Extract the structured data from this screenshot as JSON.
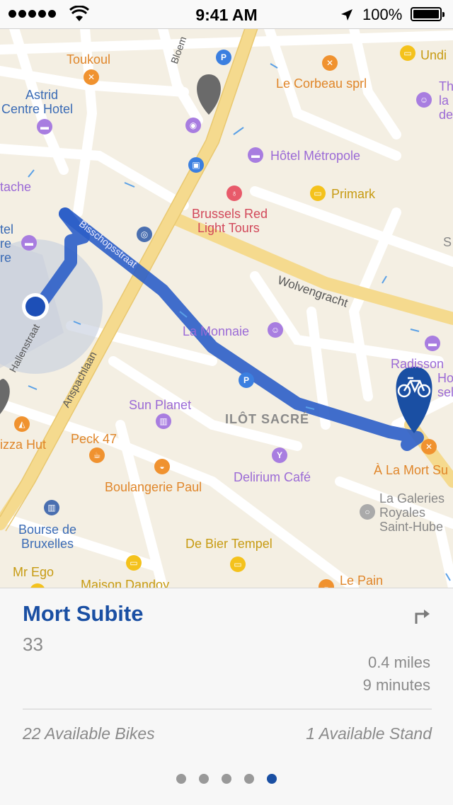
{
  "status_bar": {
    "time": "9:41 AM",
    "battery": "100%",
    "signal_dots": 5
  },
  "map": {
    "labels": {
      "toukoul": "Toukoul",
      "astrid": "Astrid",
      "centre_hotel": "Centre Hotel",
      "tache": "tache",
      "tel": "tel",
      "re": "re",
      "re2": "re",
      "corbeau": "Le Corbeau sprl",
      "metropole": "Hôtel Métropole",
      "primark": "Primark",
      "brussels_red": "Brussels Red",
      "light_tours": "Light Tours",
      "wolvengracht": "Wolvengracht",
      "bisschopsstraat": "Bisschopsstraat",
      "hallenstraat": "Hallenstraat",
      "anspachlaan": "Anspachlaan",
      "la_monnaie": "La Monnaie",
      "radisson": "Radisson",
      "ho": "Ho",
      "sel": "sel",
      "sun_planet": "Sun Planet",
      "ilot_sacre": "ILÔT SACRÉ",
      "peck47": "Peck 47",
      "izza_hut": "izza Hut",
      "a_la_mort": "À La Mort Su",
      "delirium": "Delirium Café",
      "boulangerie": "Boulangerie Paul",
      "la_galeries": "La Galeries",
      "royales": "Royales",
      "saint_hube": "Saint-Hube",
      "bourse_de": "Bourse de",
      "bruxelles": "Bruxelles",
      "de_bier": "De Bier Tempel",
      "mr_ego": "Mr Ego",
      "maison_dandoy": "Maison Dandoy",
      "le_pain": "Le Pain",
      "undi": "Undi",
      "th": "Th",
      "la": "la",
      "de": "de",
      "s_right": "S",
      "bloem": "Bloem"
    },
    "route_color": "#2c5ec8",
    "pin_color": "#1a4fa3"
  },
  "panel": {
    "station_name": "Mort Subite",
    "station_number": "33",
    "distance": "0.4 miles",
    "duration": "9 minutes",
    "available_bikes": "22 Available Bikes",
    "available_stands": "1 Available Stand",
    "page_count": 5,
    "active_page": 5
  }
}
